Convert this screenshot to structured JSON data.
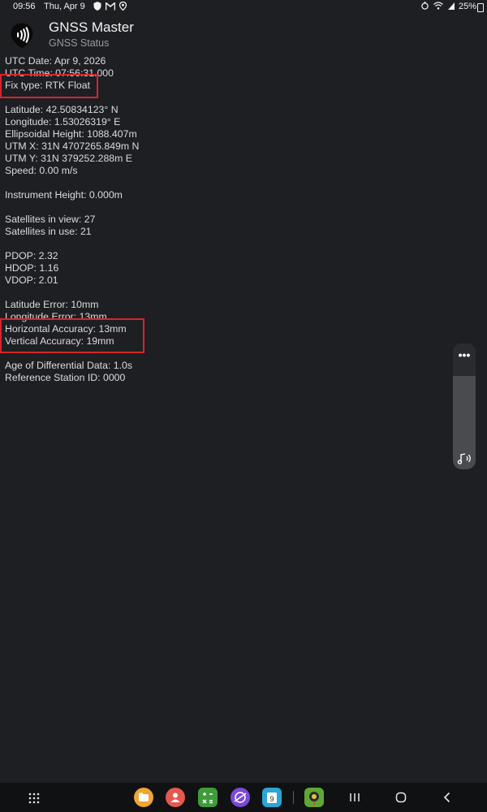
{
  "status_bar": {
    "time": "09:56",
    "date": "Thu, Apr 9",
    "left_icons": [
      "shield-icon",
      "mail-icon",
      "location-icon"
    ],
    "right_icons": [
      "alarm-icon",
      "wifi-icon",
      "signal-icon"
    ],
    "battery_text": "25%"
  },
  "app": {
    "title": "GNSS Master",
    "subtitle": "GNSS Status",
    "icon": "gnss-pin-icon"
  },
  "gnss": {
    "utc_date": "UTC Date: Apr 9, 2026",
    "utc_time": "UTC Time: 07:56:31.000",
    "fix_type": "Fix type: RTK Float",
    "latitude": "Latitude: 42.50834123° N",
    "longitude": "Longitude: 1.53026319° E",
    "ellipsoidal_height": "Ellipsoidal Height: 1088.407m",
    "utm_x": "UTM X: 31N 4707265.849m N",
    "utm_y": "UTM Y: 31N 379252.288m E",
    "speed": "Speed: 0.00 m/s",
    "instrument_height": "Instrument Height: 0.000m",
    "satellites_in_view": "Satellites in view: 27",
    "satellites_in_use": "Satellites in use: 21",
    "pdop": "PDOP: 2.32",
    "hdop": "HDOP: 1.16",
    "vdop": "VDOP: 2.01",
    "latitude_error": "Latitude Error: 10mm",
    "longitude_error": "Longitude Error: 13mm",
    "horizontal_accuracy": "Horizontal Accuracy: 13mm",
    "vertical_accuracy": "Vertical Accuracy: 19mm",
    "age_of_differential": "Age of Differential Data: 1.0s",
    "reference_station_id": "Reference Station ID: 0000"
  },
  "side_panel": {
    "menu_label": "•••",
    "icons": [
      "more-icon",
      "sound-assistant-icon"
    ]
  },
  "nav_bar": {
    "dock_apps": [
      {
        "name": "my-files-app",
        "color": "#f0a534"
      },
      {
        "name": "contacts-app",
        "color": "#e5584f"
      },
      {
        "name": "calculator-app",
        "color": "#3e9c3a"
      },
      {
        "name": "internet-app",
        "color": "#7b4ad6"
      },
      {
        "name": "calendar-app",
        "color": "#2aa5d6"
      },
      {
        "name": "gnss-master-app",
        "color": "#5fa832"
      }
    ],
    "calendar_day": "9",
    "buttons": [
      "recent-apps-icon",
      "home-icon",
      "back-icon"
    ]
  },
  "highlight_color": "#d3262d"
}
